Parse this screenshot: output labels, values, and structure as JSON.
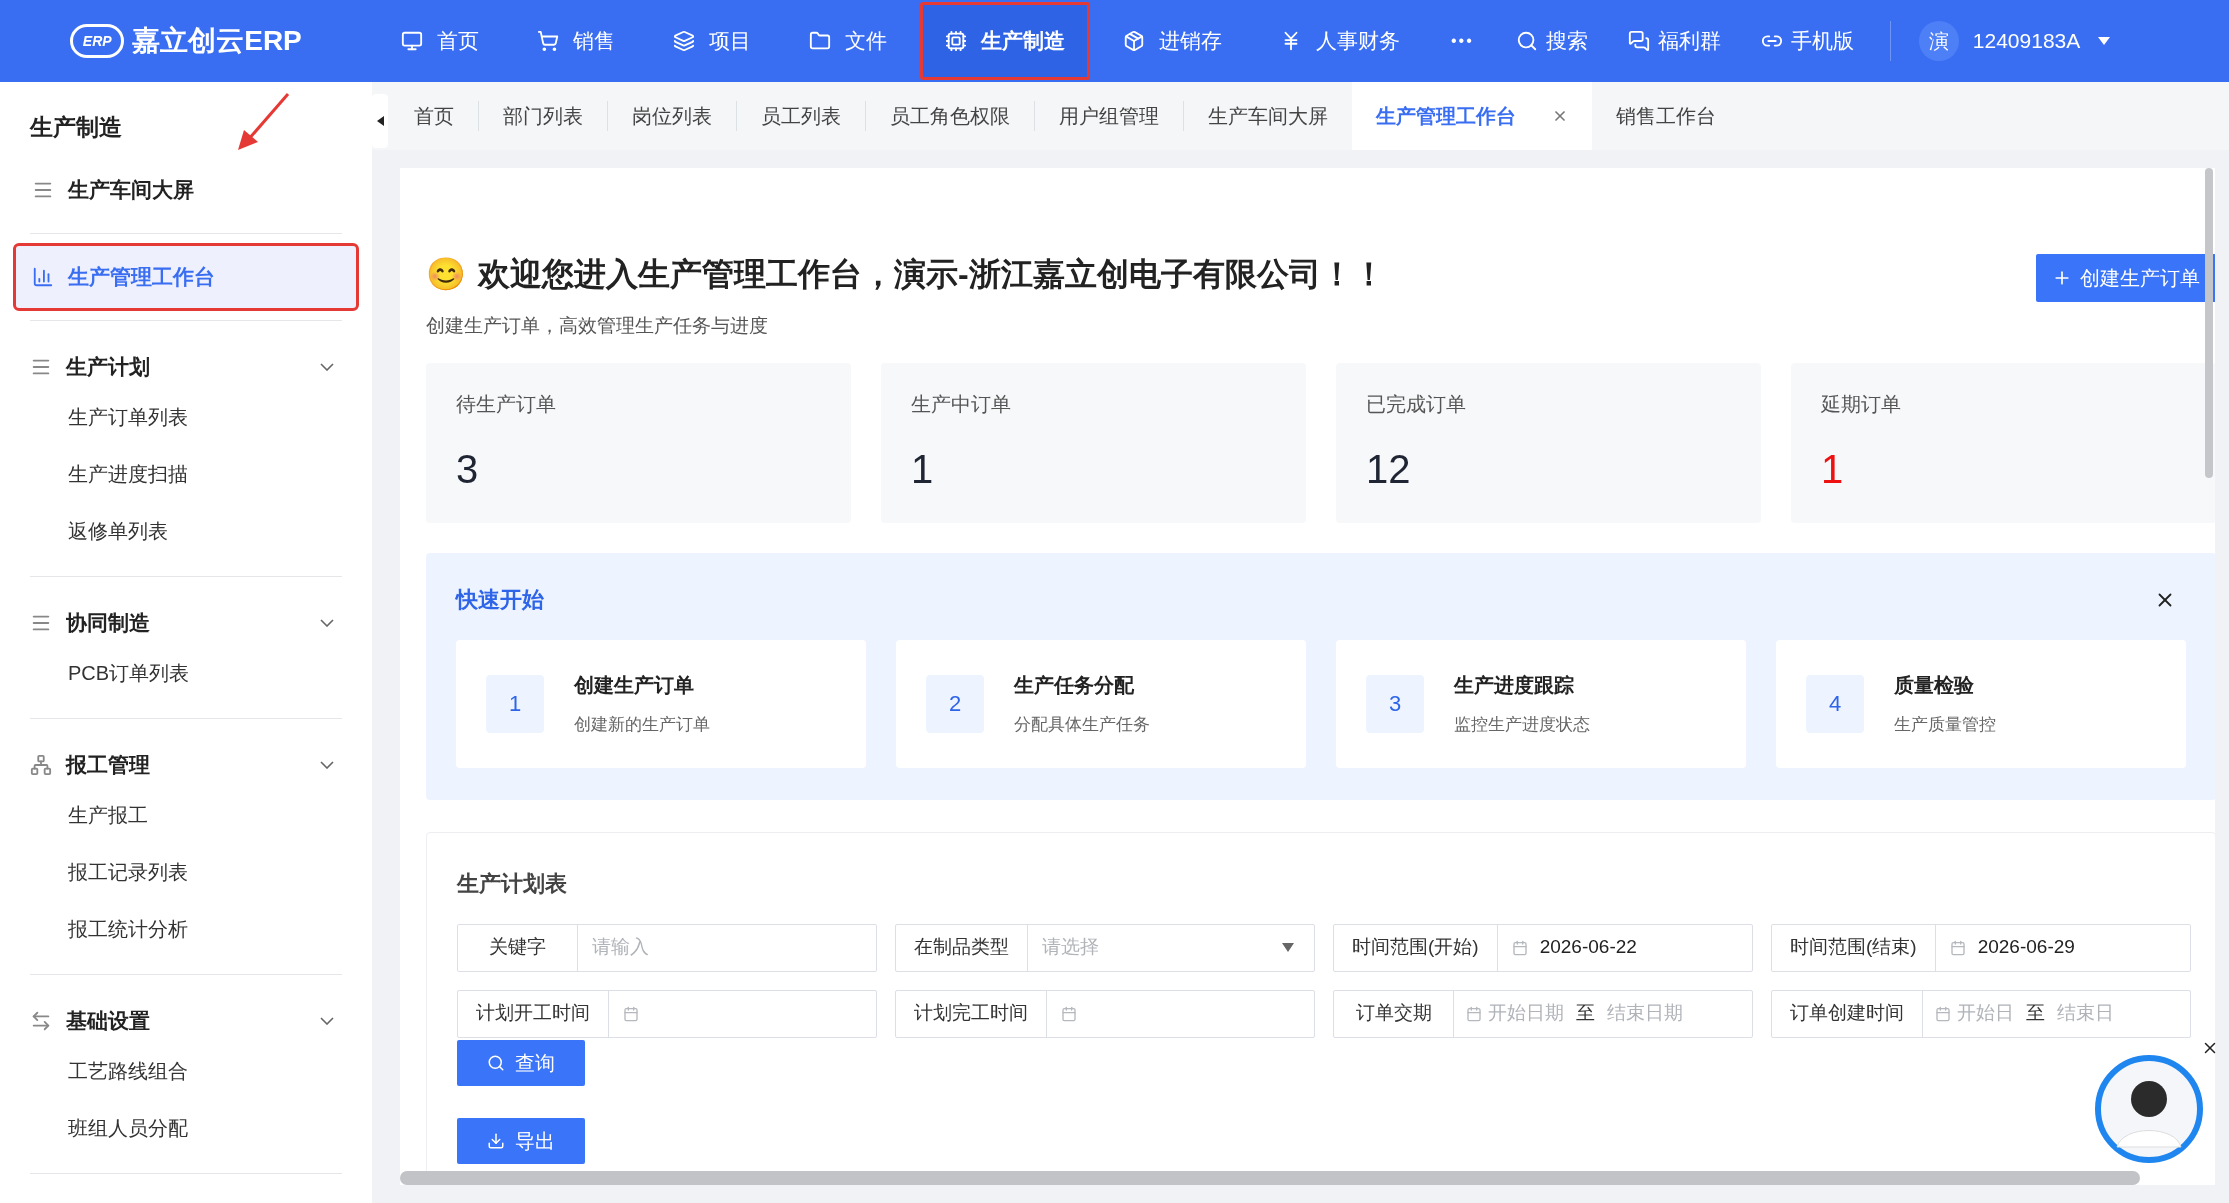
{
  "header": {
    "logo_mark": "ERP",
    "logo_text": "嘉立创云ERP",
    "nav": [
      {
        "label": "首页",
        "selected": false,
        "annotated": false
      },
      {
        "label": "销售",
        "selected": false,
        "annotated": false
      },
      {
        "label": "项目",
        "selected": false,
        "annotated": false
      },
      {
        "label": "文件",
        "selected": false,
        "annotated": false
      },
      {
        "label": "生产制造",
        "selected": true,
        "annotated": true
      },
      {
        "label": "进销存",
        "selected": false,
        "annotated": false
      },
      {
        "label": "人事财务",
        "selected": false,
        "annotated": false
      }
    ],
    "more": "•••",
    "tools": [
      "搜索",
      "福利群",
      "手机版"
    ],
    "user": {
      "avatar_char": "演",
      "name": "12409183A"
    }
  },
  "sidebar": {
    "title": "生产制造",
    "items": [
      {
        "kind": "link",
        "label": "生产车间大屏",
        "selected": false,
        "annotated": false
      },
      {
        "kind": "link",
        "label": "生产管理工作台",
        "selected": true,
        "annotated": true
      },
      {
        "kind": "group",
        "label": "生产计划",
        "expanded": true,
        "children": [
          {
            "label": "生产订单列表"
          },
          {
            "label": "生产进度扫描"
          },
          {
            "label": "返修单列表"
          }
        ]
      },
      {
        "kind": "group",
        "label": "协同制造",
        "expanded": true,
        "children": [
          {
            "label": "PCB订单列表"
          }
        ]
      },
      {
        "kind": "group",
        "label": "报工管理",
        "expanded": true,
        "children": [
          {
            "label": "生产报工"
          },
          {
            "label": "报工记录列表"
          },
          {
            "label": "报工统计分析"
          }
        ]
      },
      {
        "kind": "group",
        "label": "基础设置",
        "expanded": true,
        "children": [
          {
            "label": "工艺路线组合"
          },
          {
            "label": "班组人员分配"
          }
        ]
      }
    ]
  },
  "tabs": [
    {
      "label": "首页",
      "selected": false,
      "closable": false
    },
    {
      "label": "部门列表",
      "selected": false,
      "closable": false
    },
    {
      "label": "岗位列表",
      "selected": false,
      "closable": false
    },
    {
      "label": "员工列表",
      "selected": false,
      "closable": false
    },
    {
      "label": "员工角色权限",
      "selected": false,
      "closable": false
    },
    {
      "label": "用户组管理",
      "selected": false,
      "closable": false
    },
    {
      "label": "生产车间大屏",
      "selected": false,
      "closable": false
    },
    {
      "label": "生产管理工作台",
      "selected": true,
      "closable": true
    },
    {
      "label": "销售工作台",
      "selected": false,
      "closable": false
    }
  ],
  "welcome": {
    "emoji": "😊",
    "title": "欢迎您进入生产管理工作台，演示-浙江嘉立创电子有限公司！！",
    "subtitle": "创建生产订单，高效管理生产任务与进度",
    "button": "创建生产订单"
  },
  "stats": [
    {
      "label": "待生产订单",
      "value": "3",
      "alert": false
    },
    {
      "label": "生产中订单",
      "value": "1",
      "alert": false
    },
    {
      "label": "已完成订单",
      "value": "12",
      "alert": false
    },
    {
      "label": "延期订单",
      "value": "1",
      "alert": true
    }
  ],
  "quick_start": {
    "title": "快速开始",
    "steps": [
      {
        "number": "1",
        "title": "创建生产订单",
        "desc": "创建新的生产订单"
      },
      {
        "number": "2",
        "title": "生产任务分配",
        "desc": "分配具体生产任务"
      },
      {
        "number": "3",
        "title": "生产进度跟踪",
        "desc": "监控生产进度状态"
      },
      {
        "number": "4",
        "title": "质量检验",
        "desc": "生产质量管控"
      }
    ]
  },
  "plan": {
    "title": "生产计划表",
    "filters": [
      {
        "kind": "text",
        "label": "关键字",
        "placeholder": "请输入"
      },
      {
        "kind": "select",
        "label": "在制品类型",
        "placeholder": "请选择"
      },
      {
        "kind": "date",
        "label": "时间范围(开始)",
        "value": "2026-06-22"
      },
      {
        "kind": "date",
        "label": "时间范围(结束)",
        "value": "2026-06-29"
      },
      {
        "kind": "date",
        "label": "计划开工时间"
      },
      {
        "kind": "date",
        "label": "计划完工时间"
      },
      {
        "kind": "range",
        "label": "订单交期",
        "start_placeholder": "开始日期",
        "separator": "至",
        "end_placeholder": "结束日期"
      },
      {
        "kind": "range",
        "label": "订单创建时间",
        "start_placeholder": "开始日",
        "separator": "至",
        "end_placeholder": "结束日"
      }
    ],
    "buttons": [
      "查询",
      "导出"
    ]
  }
}
